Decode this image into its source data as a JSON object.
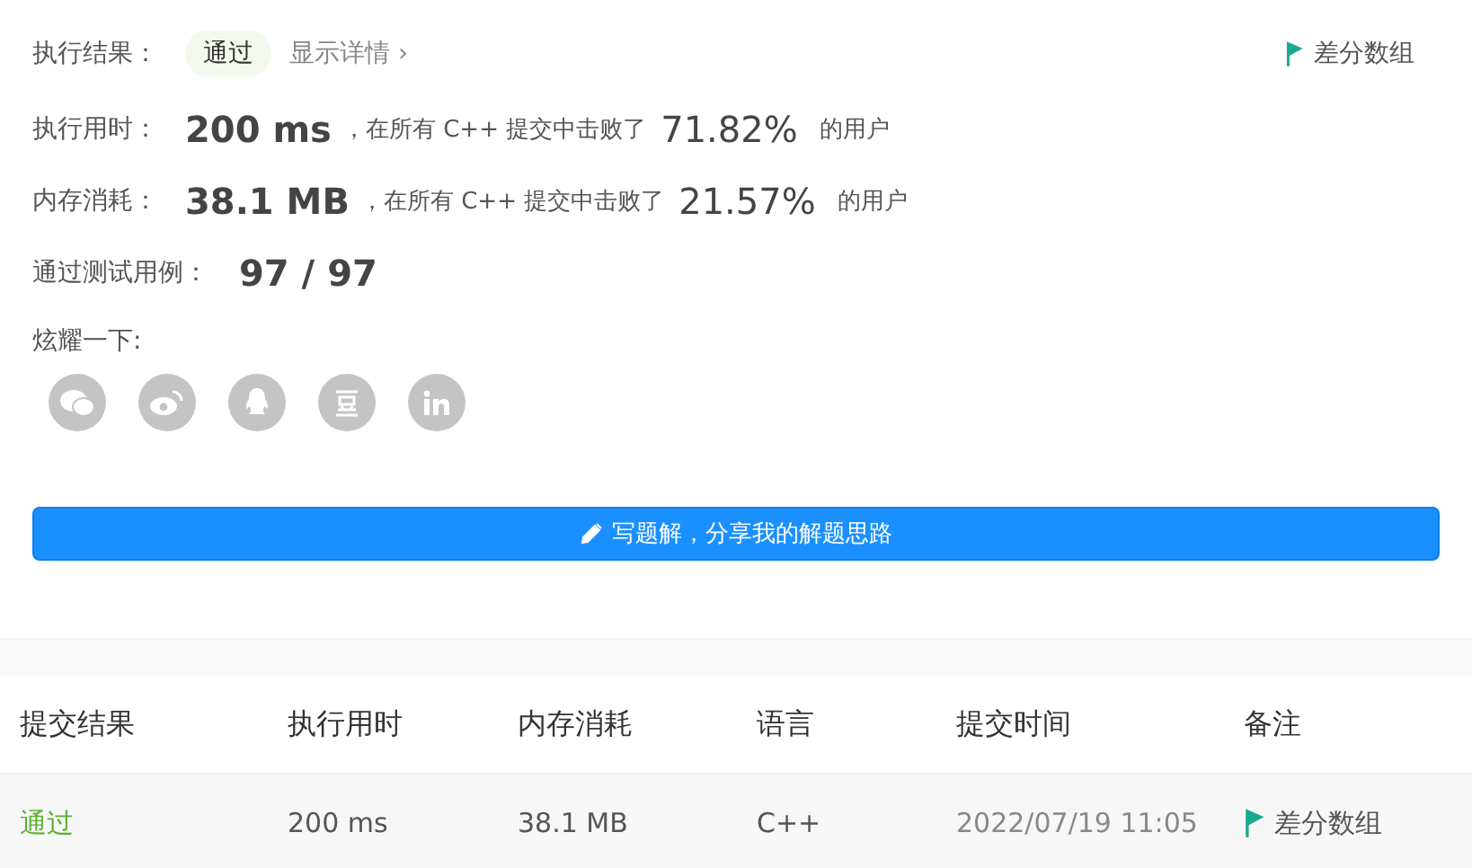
{
  "result": {
    "label": "执行结果：",
    "status": "通过",
    "details_link": "显示详情 ›",
    "diff_button": "差分数组"
  },
  "stats": [
    {
      "label": "执行用时：",
      "value": "200 ms",
      "middle": "，在所有 C++ 提交中击败了",
      "percent": "71.82%",
      "suffix": "的用户"
    },
    {
      "label": "内存消耗：",
      "value": "38.1 MB",
      "middle": "，在所有 C++ 提交中击败了",
      "percent": "21.57%",
      "suffix": "的用户"
    }
  ],
  "testcases": {
    "label": "通过测试用例：",
    "value": "97 / 97"
  },
  "share": {
    "label": "炫耀一下:"
  },
  "write_button": "写题解，分享我的解题思路",
  "table": {
    "columns": [
      "提交结果",
      "执行用时",
      "内存消耗",
      "语言",
      "提交时间",
      "备注"
    ],
    "rows": [
      {
        "status": "通过",
        "time": "200 ms",
        "memory": "38.1 MB",
        "language": "C++",
        "submitted": "2022/07/19 11:05",
        "note": "差分数组"
      }
    ]
  }
}
